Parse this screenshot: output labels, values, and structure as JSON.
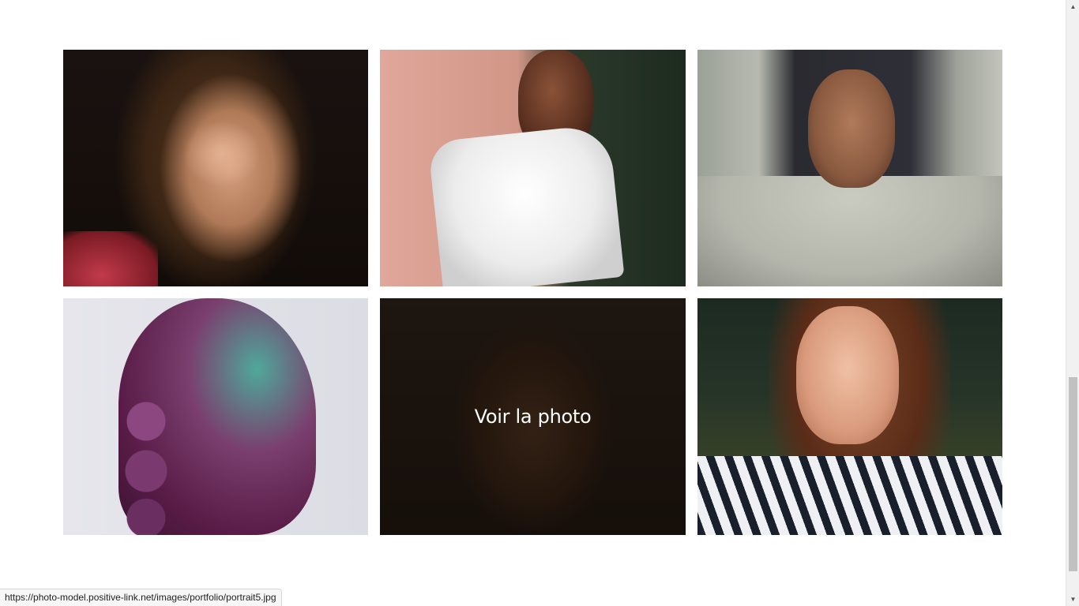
{
  "gallery": {
    "items": [
      {
        "alt_icon": "portrait-photo",
        "hovered": false
      },
      {
        "alt_icon": "portrait-photo",
        "hovered": false
      },
      {
        "alt_icon": "portrait-photo",
        "hovered": false
      },
      {
        "alt_icon": "portrait-photo",
        "hovered": false
      },
      {
        "alt_icon": "portrait-photo",
        "hovered": true
      },
      {
        "alt_icon": "portrait-photo",
        "hovered": false
      }
    ],
    "overlay_label": "Voir la photo"
  },
  "status_bar": {
    "url": "https://photo-model.positive-link.net/images/portfolio/portrait5.jpg"
  },
  "scrollbar": {
    "up_icon": "triangle-up",
    "down_icon": "triangle-down"
  },
  "colors": {
    "background": "#ffffff",
    "overlay_text": "#ffffff"
  }
}
